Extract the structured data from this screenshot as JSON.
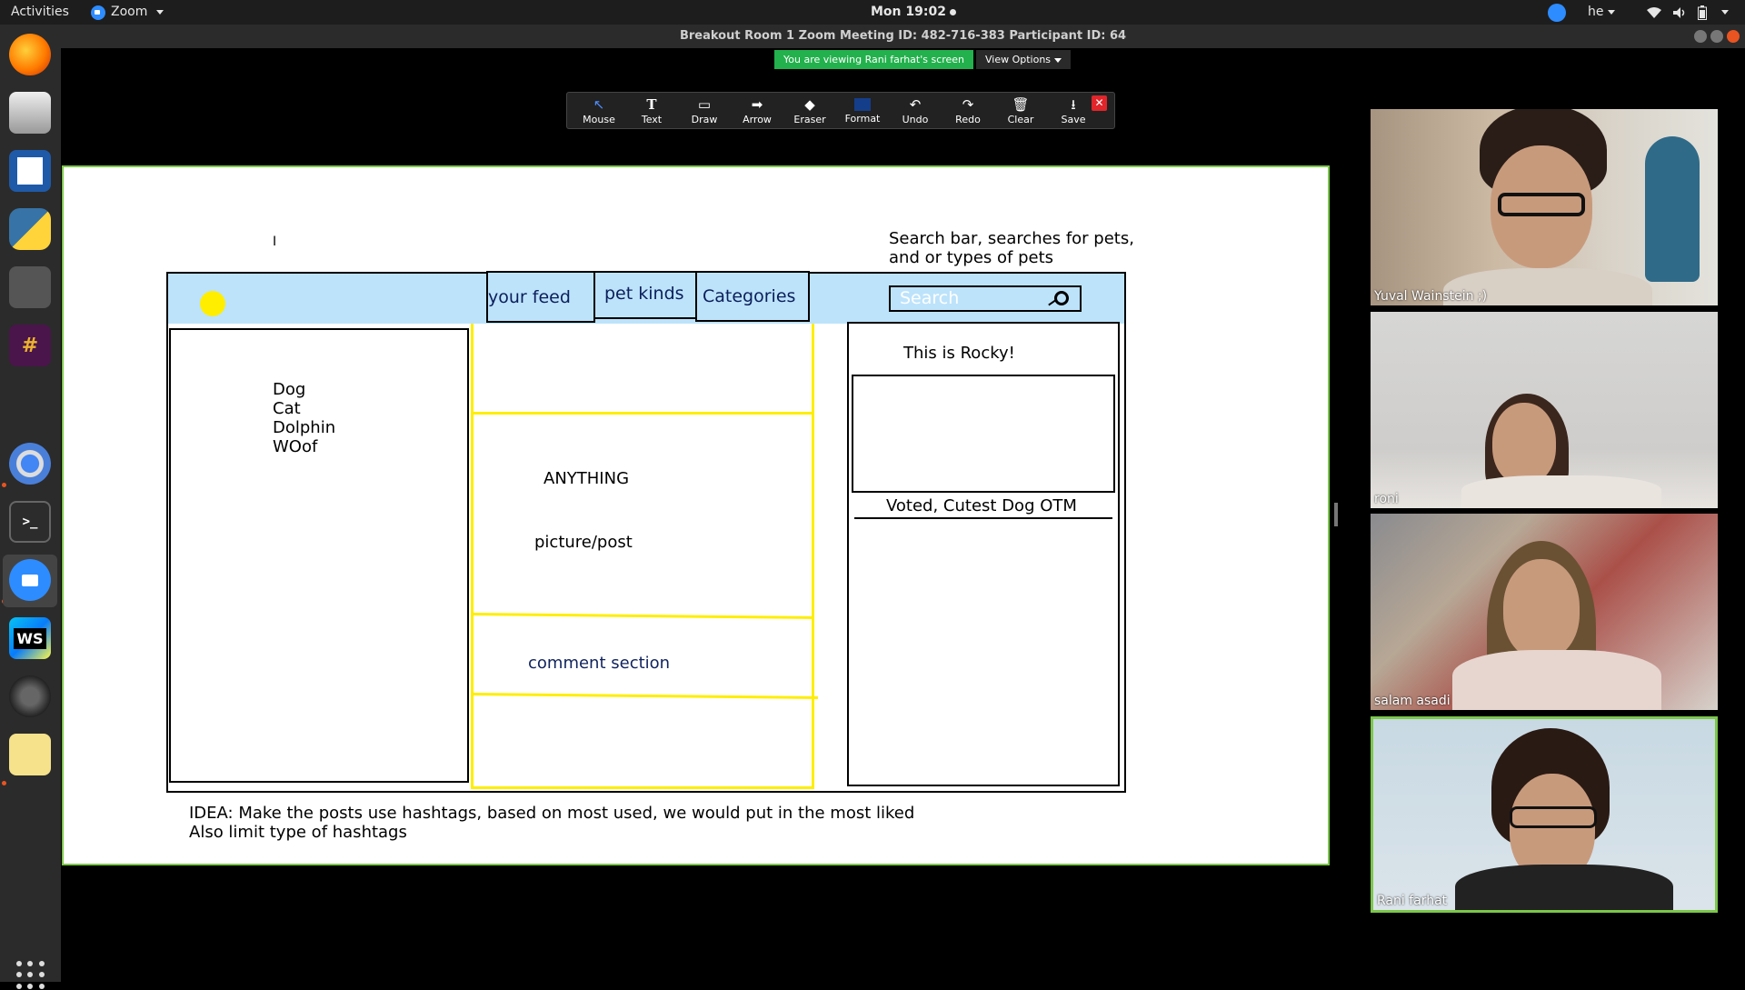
{
  "topbar": {
    "activities": "Activities",
    "app_name": "Zoom",
    "clock": "Mon 19:02",
    "language": "he"
  },
  "window": {
    "title": "Breakout Room 1   Zoom Meeting ID: 482-716-383 Participant ID: 64",
    "viewing_banner": "You are viewing Rani farhat's screen",
    "view_options": "View Options"
  },
  "annotation_toolbar": {
    "tools": [
      {
        "label": "Mouse",
        "icon": "mouse-pointer-icon"
      },
      {
        "label": "Text",
        "icon": "text-icon"
      },
      {
        "label": "Draw",
        "icon": "draw-icon"
      },
      {
        "label": "Arrow",
        "icon": "arrow-icon"
      },
      {
        "label": "Eraser",
        "icon": "eraser-icon"
      },
      {
        "label": "Format",
        "icon": "format-icon"
      },
      {
        "label": "Undo",
        "icon": "undo-icon"
      },
      {
        "label": "Redo",
        "icon": "redo-icon"
      },
      {
        "label": "Clear",
        "icon": "trash-icon"
      },
      {
        "label": "Save",
        "icon": "save-icon"
      }
    ]
  },
  "whiteboard": {
    "search_note_line1": "Search bar, searches for pets,",
    "search_note_line2": "and or types of pets",
    "nav": {
      "your_feed": "your feed",
      "pet_kinds": "pet kinds",
      "categories": "Categories",
      "search_placeholder": "Search"
    },
    "left_list": [
      "Dog",
      "Cat",
      "Dolphin",
      "WOof"
    ],
    "center": {
      "anything": "ANYTHING",
      "picture_post": "picture/post",
      "comment_section": "comment section"
    },
    "right": {
      "this_is_rocky": "This is Rocky!",
      "voted": "Voted, Cutest Dog OTM"
    },
    "idea_line1": "IDEA: Make the posts use hashtags, based on most used, we would put in the most liked",
    "idea_line2": "Also limit type of hashtags",
    "colors": {
      "nav_background": "#bde3fb",
      "highlight_yellow": "#ffee00",
      "active_border": "#7cc74a"
    }
  },
  "participants": [
    {
      "name": "Yuval Wainstein ;)"
    },
    {
      "name": "roni"
    },
    {
      "name": "salam asadi"
    },
    {
      "name": "Rani farhat"
    }
  ],
  "dock": [
    {
      "icon": "firefox-icon"
    },
    {
      "icon": "files-icon"
    },
    {
      "icon": "writer-icon"
    },
    {
      "icon": "python-icon"
    },
    {
      "icon": "gimp-icon"
    },
    {
      "icon": "slack-icon"
    },
    {
      "icon": "chromium-icon"
    },
    {
      "icon": "terminal-icon"
    },
    {
      "icon": "zoom-icon"
    },
    {
      "icon": "webstorm-icon"
    },
    {
      "icon": "settings-icon"
    },
    {
      "icon": "notes-icon"
    }
  ]
}
